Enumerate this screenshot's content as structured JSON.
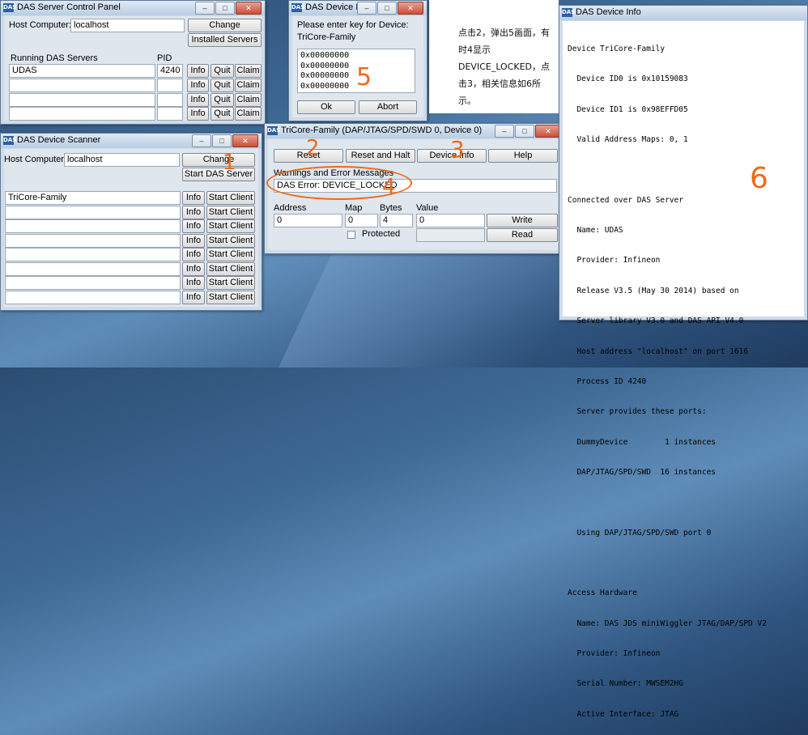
{
  "control_panel": {
    "title": "DAS Server Control Panel",
    "host_label": "Host Computer:",
    "host_value": "localhost",
    "change_btn": "Change",
    "installed_btn": "Installed Servers",
    "running_label": "Running DAS Servers",
    "pid_label": "PID",
    "rows": [
      {
        "name": "UDAS",
        "pid": "4240"
      },
      {
        "name": "",
        "pid": ""
      },
      {
        "name": "",
        "pid": ""
      },
      {
        "name": "",
        "pid": ""
      }
    ],
    "info_btn": "Info",
    "quit_btn": "Quit",
    "claim_btn": "Claim"
  },
  "device_key": {
    "title": "DAS Device Key",
    "prompt": "Please enter key for Device:",
    "device": "TriCore-Family",
    "keys": [
      "0x00000000",
      "0x00000000",
      "0x00000000",
      "0x00000000"
    ],
    "ok_btn": "Ok",
    "abort_btn": "Abort"
  },
  "note_text": "点击2，弹出5画面，有时4显示DEVICE_LOCKED，点击3，相关信息如6所示。",
  "scanner": {
    "title": "DAS Device Scanner",
    "host_label": "Host Computer:",
    "host_value": "localhost",
    "change_btn": "Change",
    "start_server_btn": "Start DAS Server",
    "rows": [
      "TriCore-Family",
      "",
      "",
      "",
      "",
      "",
      "",
      ""
    ],
    "info_btn": "Info",
    "start_client_btn": "Start Client"
  },
  "tricore": {
    "title": "TriCore-Family (DAP/JTAG/SPD/SWD 0, Device 0)",
    "reset_btn": "Reset",
    "reset_halt_btn": "Reset and Halt",
    "device_info_btn": "Device Info",
    "help_btn": "Help",
    "warnings_label": "Warnings and Error Messages",
    "error_text": "DAS Error: DEVICE_LOCKED",
    "address_label": "Address",
    "map_label": "Map",
    "bytes_label": "Bytes",
    "value_label": "Value",
    "address_value": "0",
    "map_value": "0",
    "bytes_value": "4",
    "value_value": "0",
    "write_btn": "Write",
    "protected_label": "Protected",
    "read_btn": "Read"
  },
  "device_info": {
    "title": "DAS Device Info",
    "lines": [
      "Device TriCore-Family",
      "  Device ID0 is 0x10159083",
      "  Device ID1 is 0x98EFFD05",
      "  Valid Address Maps: 0, 1",
      "",
      "Connected over DAS Server",
      "  Name: UDAS",
      "  Provider: Infineon",
      "  Release V3.5 (May 30 2014) based on",
      "  Server library V3.0 and DAS API V4.0",
      "  Host address \"localhost\" on port 1616",
      "  Process ID 4240",
      "  Server provides these ports:",
      "  DummyDevice        1 instances",
      "  DAP/JTAG/SPD/SWD  16 instances",
      "",
      "  Using DAP/JTAG/SPD/SWD port 0",
      "",
      "Access Hardware",
      "  Name: DAS JDS miniWiggler JTAG/DAP/SPD V2",
      "  Provider: Infineon",
      "  Serial Number: MWSEM2HG",
      "  Active Interface: JTAG"
    ]
  },
  "annotations": [
    "1",
    "2",
    "3",
    "4",
    "5",
    "6"
  ],
  "window_controls": {
    "minimize": "–",
    "maximize": "□",
    "close": "✕"
  },
  "colors": {
    "annotation": "#ee6a18",
    "titlebar": "#c8d8ea"
  }
}
